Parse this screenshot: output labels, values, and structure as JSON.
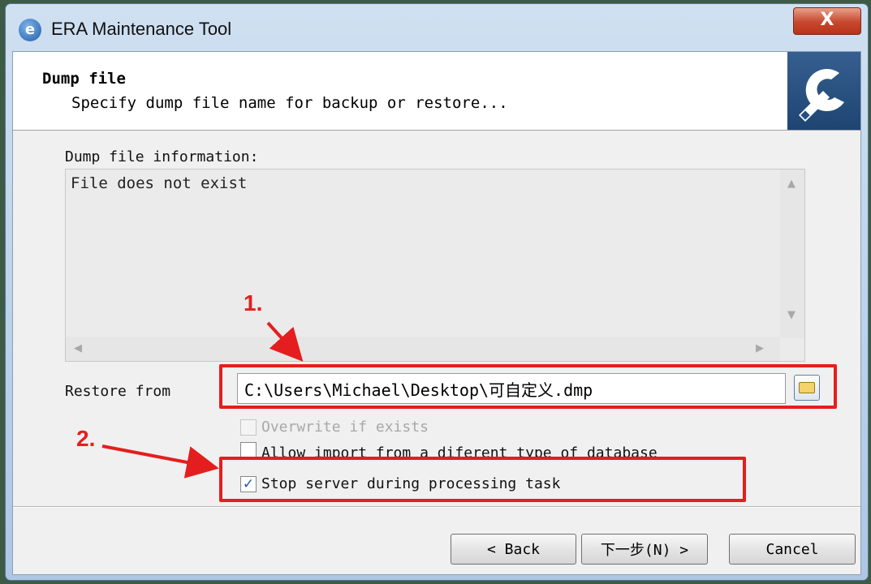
{
  "window": {
    "title": "ERA Maintenance Tool",
    "close_glyph": "X"
  },
  "header": {
    "title": "Dump file",
    "subtitle": "Specify dump file name for backup or restore..."
  },
  "info": {
    "label": "Dump file information:",
    "text": "File does not exist"
  },
  "restore": {
    "label": "Restore from",
    "path": "C:\\Users\\Michael\\Desktop\\可自定义.dmp",
    "browse_icon": "folder-icon"
  },
  "options": [
    {
      "label": "Overwrite if exists",
      "checked": false,
      "disabled": true
    },
    {
      "label": "Allow import from a diferent type of database",
      "checked": false,
      "disabled": false
    },
    {
      "label": "Stop server during processing task",
      "checked": true,
      "disabled": false
    }
  ],
  "buttons": {
    "back": "< Back",
    "next": "下一步(N) >",
    "cancel": "Cancel"
  },
  "annotations": {
    "step1": "1.",
    "step2": "2."
  },
  "colors": {
    "annotation": "#e41e1e",
    "header_logo": "#274f80"
  }
}
